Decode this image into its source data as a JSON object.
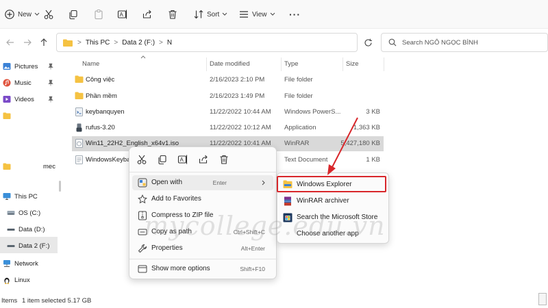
{
  "toolbar": {
    "new_label": "New",
    "sort_label": "Sort",
    "view_label": "View",
    "more_label": "···"
  },
  "address": {
    "segments": [
      "This PC",
      "Data 2 (F:)",
      "N"
    ],
    "separator": ">"
  },
  "search": {
    "placeholder": "Search NGÔ NGỌC BÌNH"
  },
  "sidebar": {
    "items": [
      {
        "label": "Pictures",
        "icon": "pictures-icon"
      },
      {
        "label": "Music",
        "icon": "music-icon"
      },
      {
        "label": "Videos",
        "icon": "videos-icon"
      },
      {
        "label": "",
        "icon": "folder-icon"
      },
      {
        "label": "mec",
        "icon": "folder-icon"
      },
      {
        "label": "This PC",
        "icon": "pc-icon"
      },
      {
        "label": "OS (C:)",
        "icon": "drive-icon"
      },
      {
        "label": "Data (D:)",
        "icon": "drive-icon"
      },
      {
        "label": "Data 2 (F:)",
        "icon": "drive-icon"
      },
      {
        "label": "Network",
        "icon": "network-icon"
      },
      {
        "label": "Linux",
        "icon": "linux-icon"
      }
    ]
  },
  "columns": {
    "name": "Name",
    "date": "Date modified",
    "type": "Type",
    "size": "Size"
  },
  "files": [
    {
      "name": "Công việc",
      "date": "2/16/2023 2:10 PM",
      "type": "File folder",
      "size": "",
      "icon": "folder-icon"
    },
    {
      "name": "Phần mềm",
      "date": "2/16/2023 1:49 PM",
      "type": "File folder",
      "size": "",
      "icon": "folder-icon"
    },
    {
      "name": "keybanquyen",
      "date": "11/22/2022 10:44 AM",
      "type": "Windows PowerS...",
      "size": "3 KB",
      "icon": "script-icon"
    },
    {
      "name": "rufus-3.20",
      "date": "11/22/2022 10:12 AM",
      "type": "Application",
      "size": "1,363 KB",
      "icon": "usb-app-icon"
    },
    {
      "name": "Win11_22H2_English_x64v1.iso",
      "date": "11/22/2022 10:41 AM",
      "type": "WinRAR",
      "size": "5,427,180 KB",
      "icon": "iso-icon"
    },
    {
      "name": "WindowsKeyba",
      "date": "",
      "type": "Text Document",
      "size": "1 KB",
      "icon": "text-file-icon"
    }
  ],
  "context_menu": {
    "items": [
      {
        "label": "Open with",
        "shortcut": "Enter",
        "icon": "open-with-icon",
        "has_submenu": true
      },
      {
        "label": "Add to Favorites",
        "shortcut": "",
        "icon": "star-icon"
      },
      {
        "label": "Compress to ZIP file",
        "shortcut": "",
        "icon": "zip-icon"
      },
      {
        "label": "Copy as path",
        "shortcut": "Ctrl+Shift+C",
        "icon": "copy-path-icon"
      },
      {
        "label": "Properties",
        "shortcut": "Alt+Enter",
        "icon": "wrench-icon"
      },
      {
        "label": "Show more options",
        "shortcut": "Shift+F10",
        "icon": "more-options-icon"
      }
    ]
  },
  "submenu": {
    "items": [
      {
        "label": "Windows Explorer",
        "icon": "explorer-folder-icon"
      },
      {
        "label": "WinRAR archiver",
        "icon": "winrar-icon"
      },
      {
        "label": "Search the Microsoft Store",
        "icon": "store-icon"
      },
      {
        "label": "Choose another app",
        "icon": ""
      }
    ]
  },
  "status": {
    "items_count": "Items",
    "selected": "1 item selected  5.17 GB"
  },
  "watermark": "mycollege.edu.vn",
  "colors": {
    "highlight": "#d8262a",
    "arrow": "#d8262a",
    "folder": "#f5c242",
    "selection": "#d9d9d9"
  }
}
